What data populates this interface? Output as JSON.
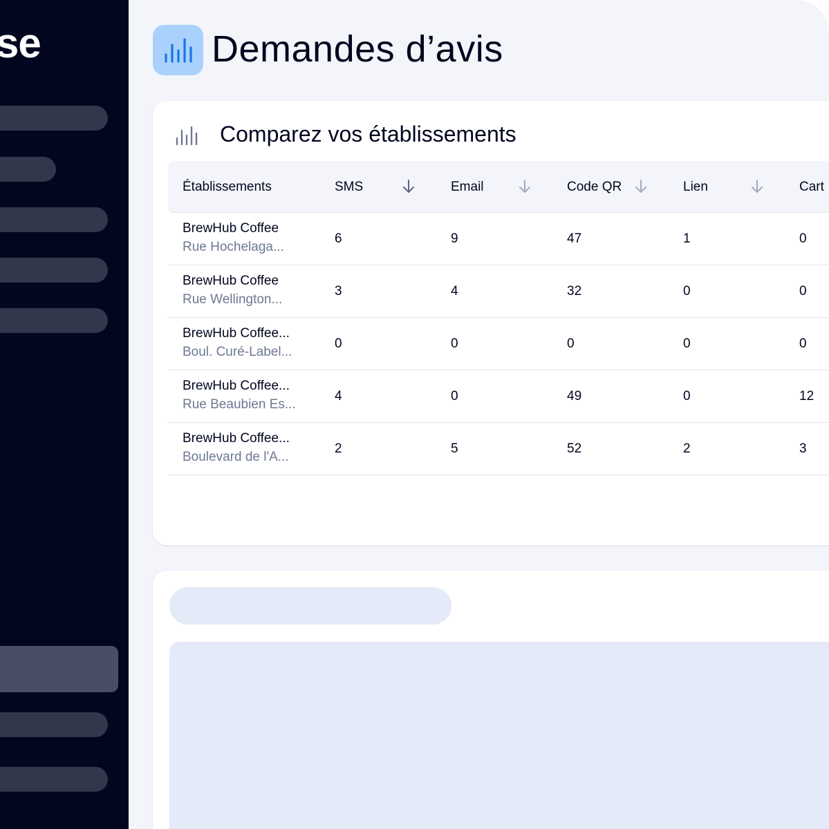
{
  "sidebar": {
    "brand_fragment": "se"
  },
  "header": {
    "title": "Demandes d’avis",
    "icon": "bar-chart-icon",
    "accent_color": "#1a73e8"
  },
  "comparison": {
    "title": "Comparez vos établissements",
    "icon": "bar-chart-icon",
    "columns": [
      {
        "label": "Établissements"
      },
      {
        "label": "SMS",
        "sortable": true
      },
      {
        "label": "Email",
        "sortable": true
      },
      {
        "label": "Code QR",
        "sortable": true
      },
      {
        "label": "Lien",
        "sortable": true
      },
      {
        "label": "Cart"
      }
    ],
    "rows": [
      {
        "name": "BrewHub Coffee",
        "address": "Rue Hochelaga...",
        "sms": "6",
        "email": "9",
        "qr": "47",
        "lien": "1",
        "cart": "0"
      },
      {
        "name": "BrewHub Coffee",
        "address": "Rue Wellington...",
        "sms": "3",
        "email": "4",
        "qr": "32",
        "lien": "0",
        "cart": "0"
      },
      {
        "name": "BrewHub Coffee...",
        "address": "Boul. Curé-Label...",
        "sms": "0",
        "email": "0",
        "qr": "0",
        "lien": "0",
        "cart": "0"
      },
      {
        "name": "BrewHub Coffee...",
        "address": "Rue Beaubien Es...",
        "sms": "4",
        "email": "0",
        "qr": "49",
        "lien": "0",
        "cart": "12"
      },
      {
        "name": "BrewHub Coffee...",
        "address": "Boulevard de l'A...",
        "sms": "2",
        "email": "5",
        "qr": "52",
        "lien": "2",
        "cart": "3"
      }
    ]
  }
}
